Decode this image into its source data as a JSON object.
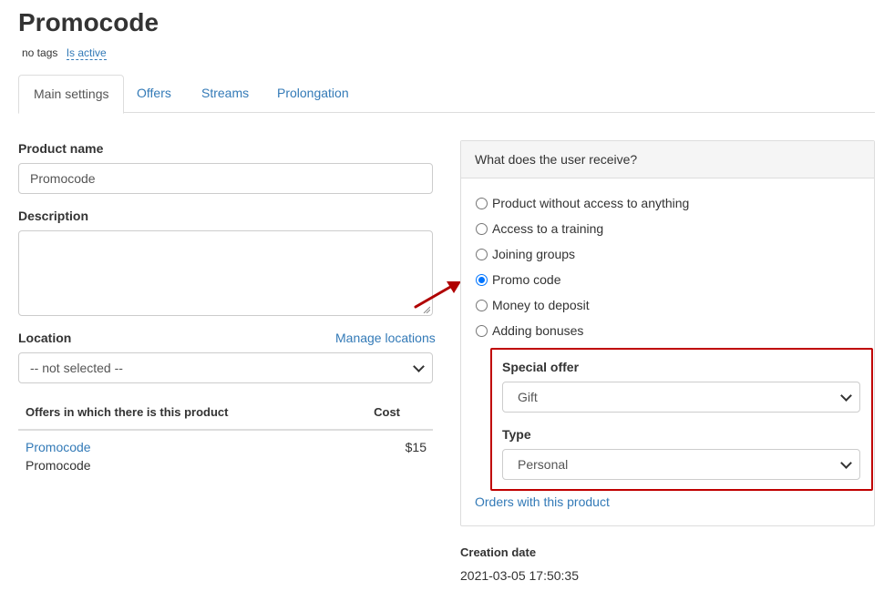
{
  "header": {
    "title": "Promocode",
    "tags": "no tags",
    "status": "Is active"
  },
  "tabs": [
    {
      "label": "Main settings",
      "active": true
    },
    {
      "label": "Offers",
      "active": false
    },
    {
      "label": "Streams",
      "active": false
    },
    {
      "label": "Prolongation",
      "active": false
    }
  ],
  "form": {
    "product_name_label": "Product name",
    "product_name_value": "Promocode",
    "description_label": "Description",
    "description_value": "",
    "location_label": "Location",
    "manage_locations_link": "Manage locations",
    "location_selected": "-- not selected --"
  },
  "offers_table": {
    "col_offer": "Offers in which there is this product",
    "col_cost": "Cost",
    "rows": [
      {
        "offer_link": "Promocode",
        "offer_subtitle": "Promocode",
        "cost": "$15"
      }
    ]
  },
  "receive_panel": {
    "title": "What does the user receive?",
    "options": [
      {
        "label": "Product without access to anything",
        "checked": false
      },
      {
        "label": "Access to a training",
        "checked": false
      },
      {
        "label": "Joining groups",
        "checked": false
      },
      {
        "label": "Promo code",
        "checked": true
      },
      {
        "label": "Money to deposit",
        "checked": false
      },
      {
        "label": "Adding bonuses",
        "checked": false
      }
    ],
    "special_offer_label": "Special offer",
    "special_offer_selected": "Gift",
    "type_label": "Type",
    "type_selected": "Personal",
    "orders_link": "Orders with this product"
  },
  "creation": {
    "label": "Creation date",
    "value": "2021-03-05 17:50:35"
  },
  "colors": {
    "link": "#337ab7",
    "highlight": "#c00000",
    "radio_checked": "#0075ff"
  }
}
